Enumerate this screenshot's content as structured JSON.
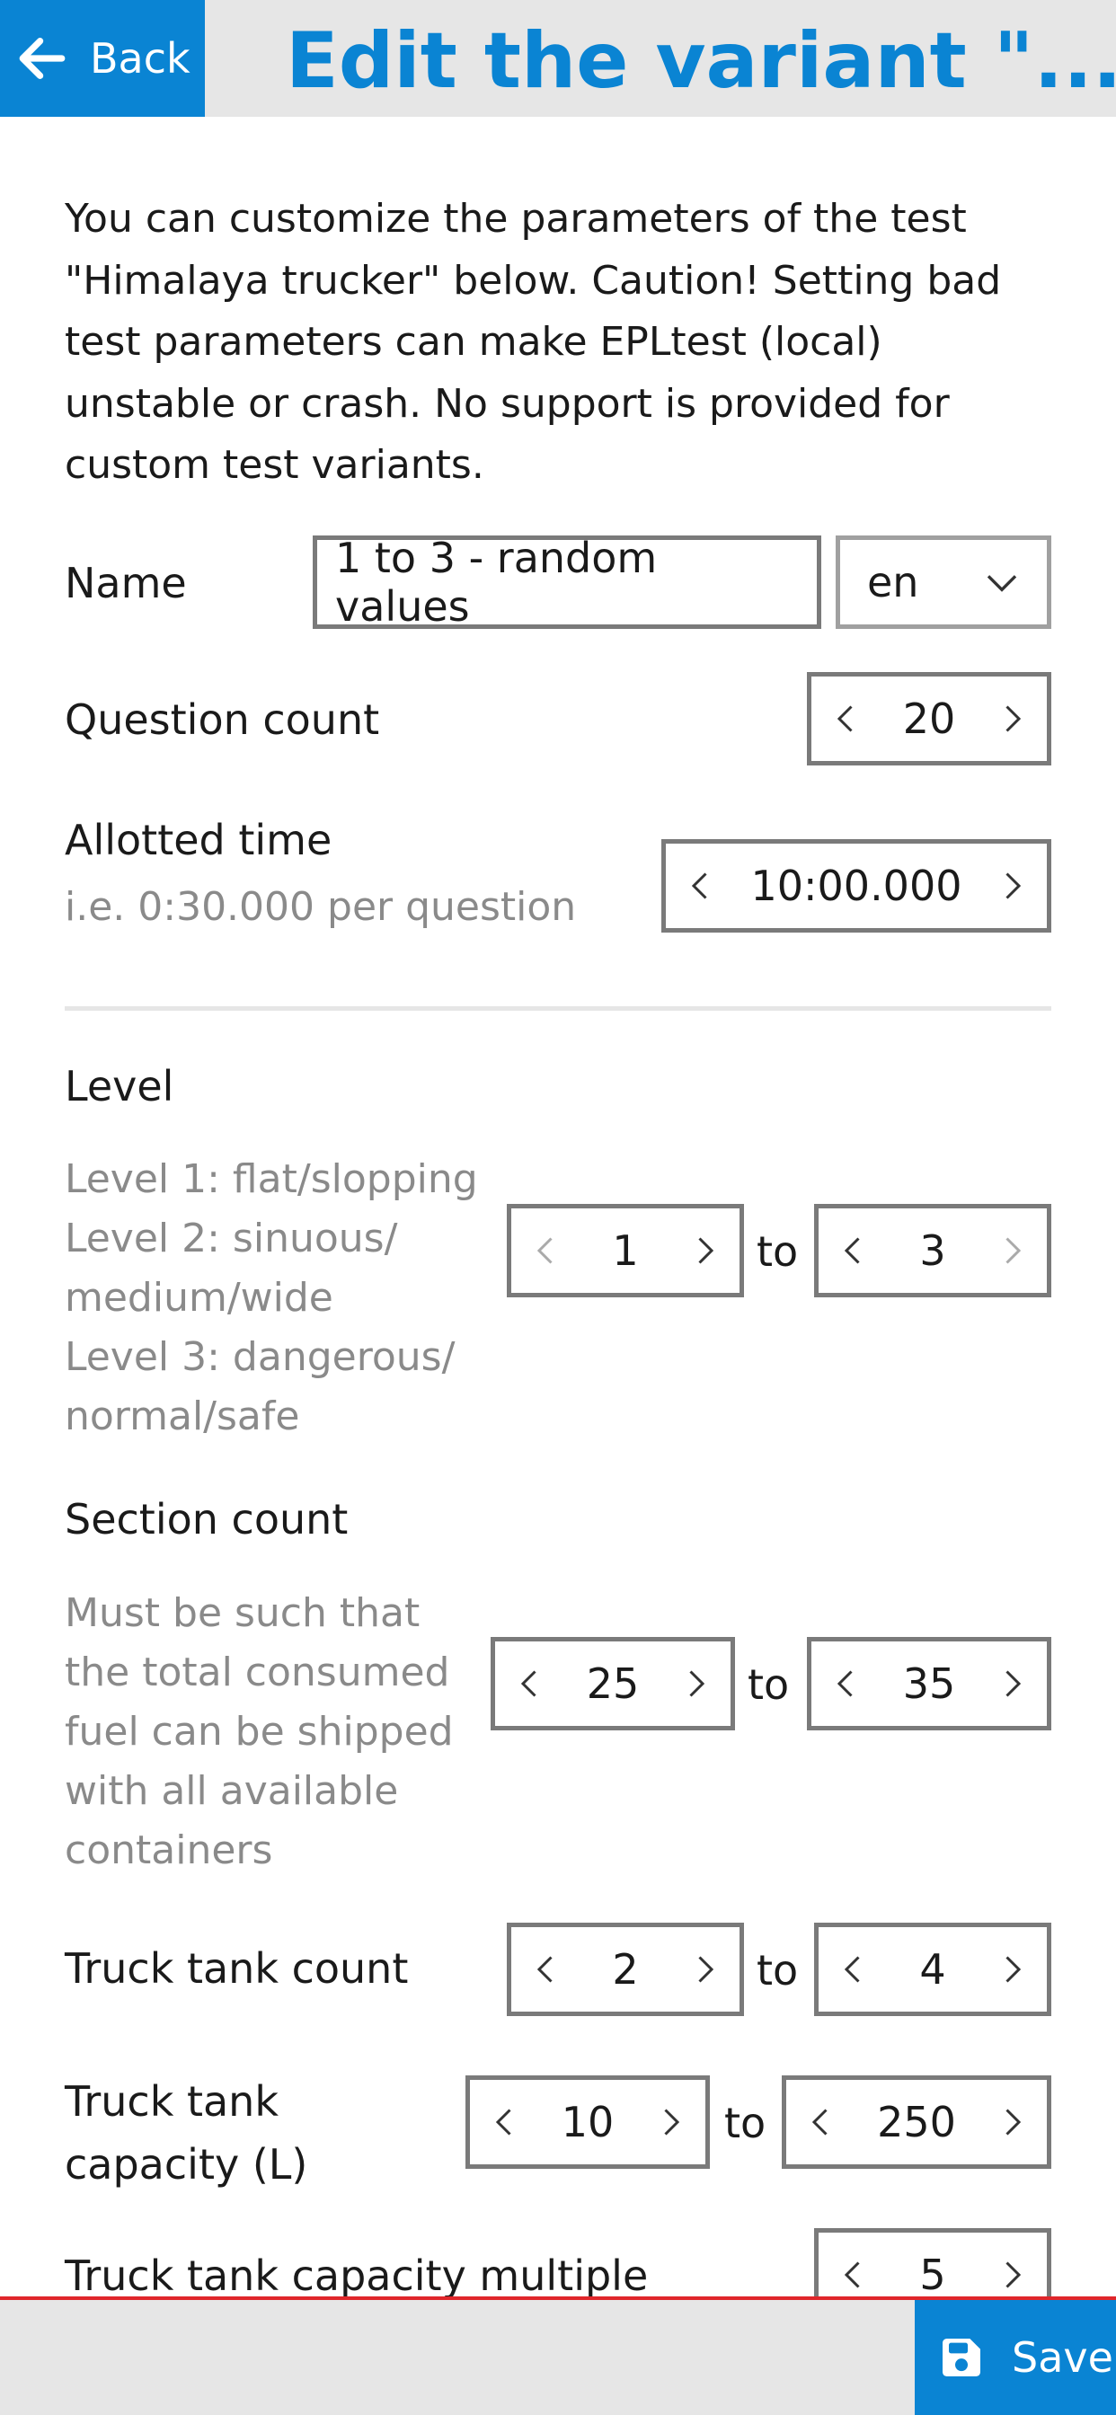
{
  "header": {
    "back_label": "Back",
    "title": "Edit the variant \"..."
  },
  "intro": "You can customize the parameters of the test \"Himalaya trucker\" below. Caution! Setting bad test parameters can make EPLtest (local) unstable or crash. No support is provided for custom test variants.",
  "name": {
    "label": "Name",
    "value": "1 to 3 - random values",
    "language": "en"
  },
  "question_count": {
    "label": "Question count",
    "value": "20"
  },
  "allotted_time": {
    "label": "Allotted time",
    "hint": "i.e. 0:30.000 per question",
    "value": "10:00.000"
  },
  "level": {
    "label": "Level",
    "desc": [
      "Level 1: flat/slopping",
      "Level 2: sinuous/",
      "medium/wide",
      "Level 3: dangerous/",
      "normal/safe"
    ],
    "min": "1",
    "max": "3"
  },
  "section_count": {
    "label": "Section count",
    "desc": [
      "Must be such that",
      "the total consumed",
      "fuel can be shipped",
      "with all available",
      "containers"
    ],
    "min": "25",
    "max": "35"
  },
  "truck_tank_count": {
    "label": "Truck tank count",
    "min": "2",
    "max": "4"
  },
  "truck_tank_capacity": {
    "label_line1": "Truck tank",
    "label_line2": "capacity (L)",
    "min": "10",
    "max": "250"
  },
  "truck_tank_capacity_multiple": {
    "label": "Truck tank capacity multiple",
    "value": "5"
  },
  "range_separator": "to",
  "footer": {
    "save_label": "Save"
  },
  "colors": {
    "accent": "#0a84d3",
    "footer_border": "#e0262b",
    "header_bg": "#e6e6e6"
  }
}
